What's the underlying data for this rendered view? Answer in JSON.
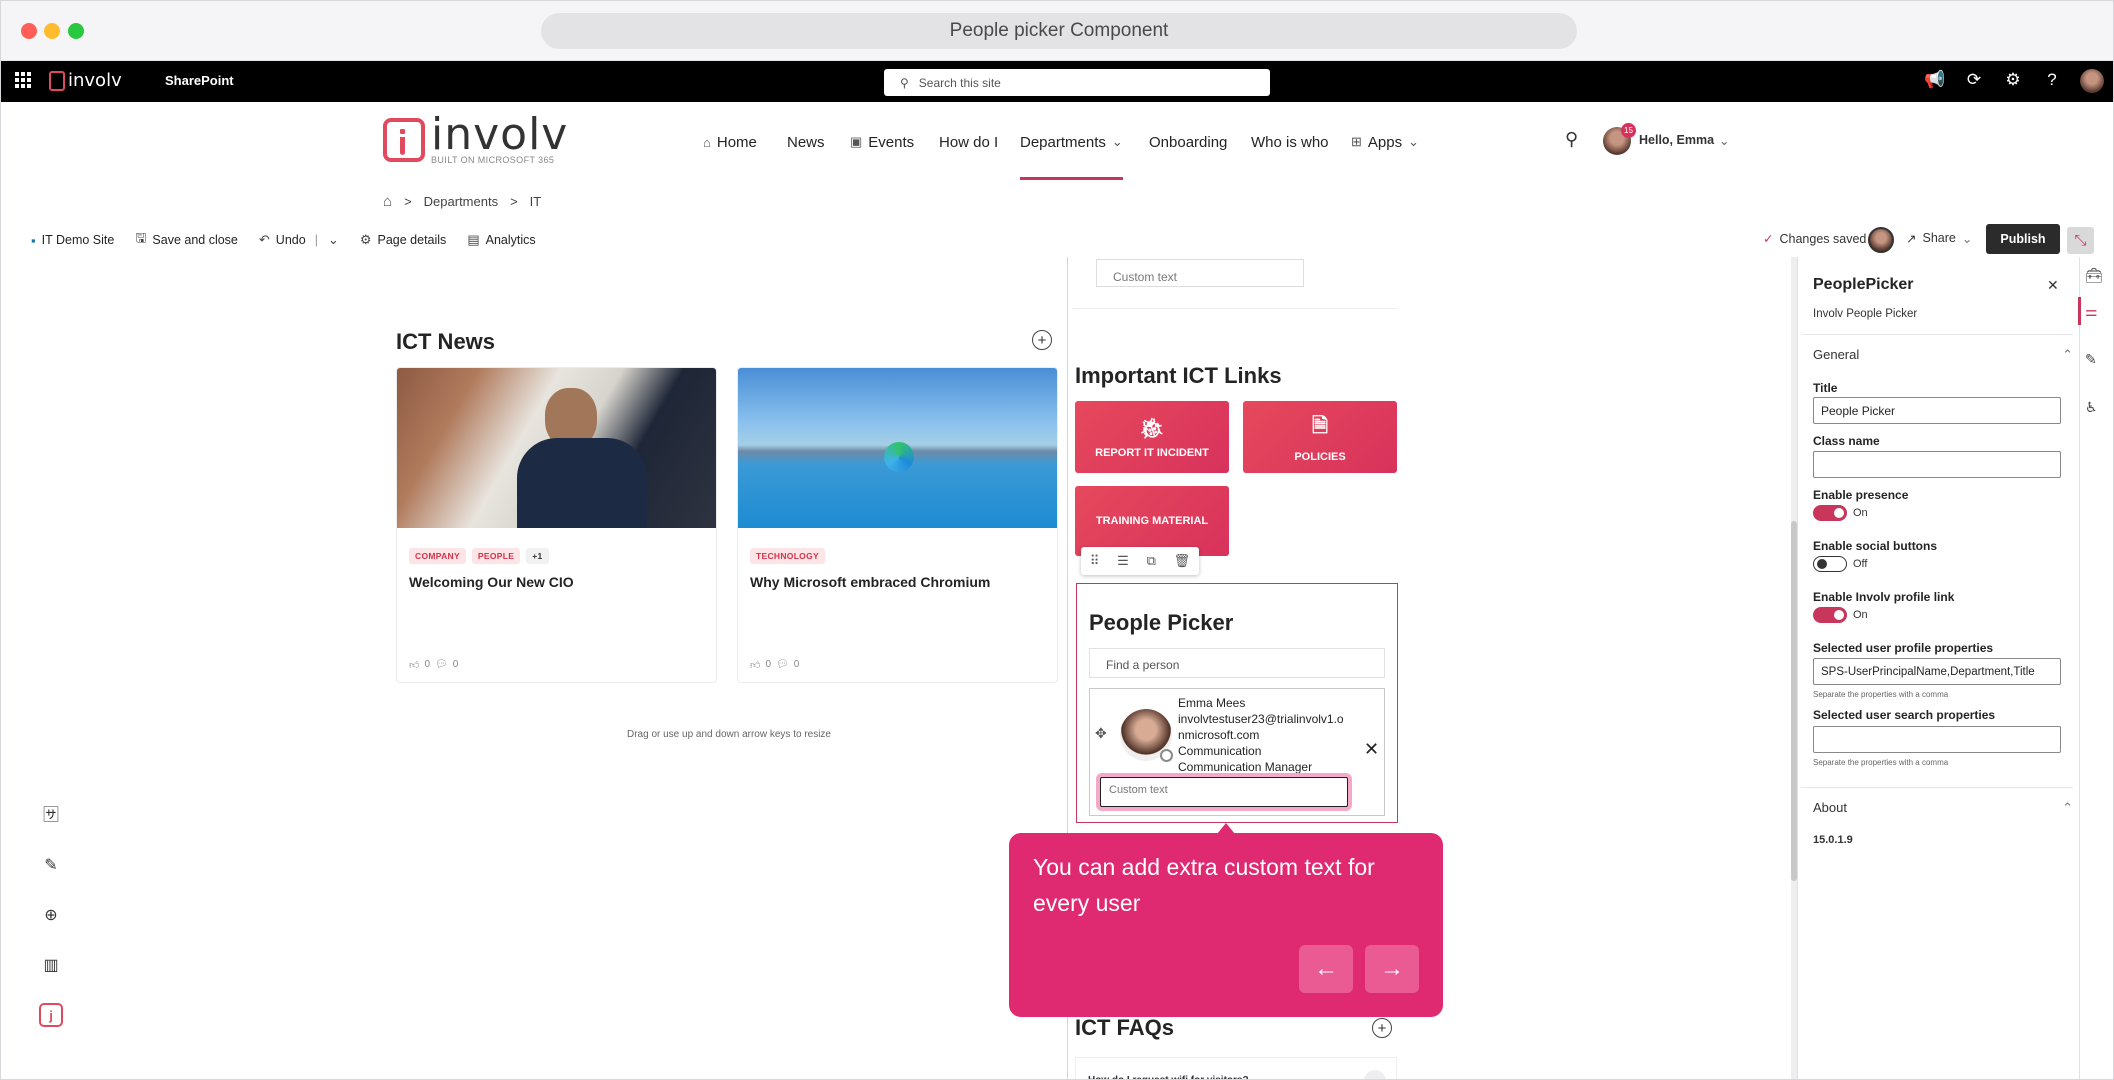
{
  "window": {
    "title": "People picker Component"
  },
  "suitebar": {
    "app_name": "SharePoint",
    "search_placeholder": "Search this site"
  },
  "brand": {
    "name": "involv",
    "tagline": "BUILT ON MICROSOFT 365"
  },
  "nav": {
    "items": [
      "Home",
      "News",
      "Events",
      "How do I",
      "Departments",
      "Onboarding",
      "Who is who",
      "Apps"
    ],
    "user_greeting": "Hello, Emma",
    "notification_count": "15"
  },
  "breadcrumb": {
    "home_icon": "home-icon",
    "separator": ">",
    "items": [
      "Departments",
      "IT"
    ]
  },
  "toolbar": {
    "site": "IT Demo Site",
    "save_close": "Save and close",
    "undo": "Undo",
    "page_details": "Page details",
    "analytics": "Analytics",
    "changes_saved": "Changes saved",
    "share": "Share",
    "publish": "Publish"
  },
  "news": {
    "title": "ICT News",
    "resize_hint": "Drag or use up and down arrow keys to resize",
    "cards": [
      {
        "tags": [
          "COMPANY",
          "PEOPLE",
          "+1"
        ],
        "title": "Welcoming Our New CIO",
        "likes": "0",
        "comments": "0"
      },
      {
        "tags": [
          "TECHNOLOGY"
        ],
        "title": "Why Microsoft embraced Chromium",
        "likes": "0",
        "comments": "0"
      }
    ]
  },
  "top_custom_text": "Custom text",
  "links": {
    "title": "Important ICT Links",
    "tiles": [
      "REPORT IT INCIDENT",
      "POLICIES",
      "TRAINING MATERIAL"
    ]
  },
  "people_picker": {
    "title": "People Picker",
    "search_placeholder": "Find a person",
    "person": {
      "name": "Emma Mees",
      "email_line1": "involvtestuser23@trialinvolv1.o",
      "email_line2": "nmicrosoft.com",
      "department": "Communication",
      "job_title": "Communication Manager"
    },
    "custom_text_placeholder": "Custom text"
  },
  "tooltip": {
    "text": "You can add extra custom text for every user"
  },
  "faqs": {
    "title": "ICT FAQs",
    "first_question": "How do I request wifi for visitors?"
  },
  "panel": {
    "title": "PeoplePicker",
    "subtitle": "Involv People Picker",
    "general": "General",
    "title_label": "Title",
    "title_value": "People Picker",
    "class_label": "Class name",
    "class_value": "",
    "presence_label": "Enable presence",
    "presence_state": "On",
    "social_label": "Enable social buttons",
    "social_state": "Off",
    "profile_link_label": "Enable Involv profile link",
    "profile_link_state": "On",
    "profile_props_label": "Selected user profile properties",
    "profile_props_value": "SPS-UserPrincipalName,Department,Title",
    "profile_props_note": "Separate the properties with a comma",
    "search_props_label": "Selected user search properties",
    "search_props_value": "",
    "search_props_note": "Separate the properties with a comma",
    "about": "About",
    "version": "15.0.1.9"
  },
  "colors": {
    "accent": "#c8375b",
    "publish": "#2b2b2b",
    "tooltip": "#df2a72",
    "tile": "#e2435c"
  }
}
